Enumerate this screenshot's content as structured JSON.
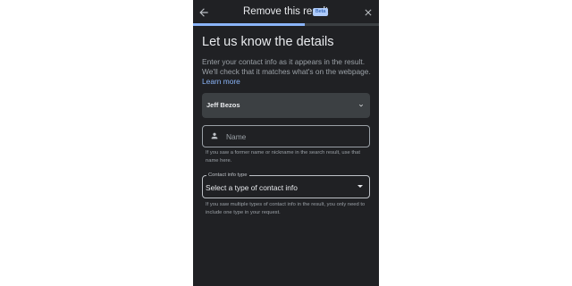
{
  "header": {
    "title": "Remove this result",
    "badge": "Beta"
  },
  "progress": {
    "fraction": 0.6
  },
  "main": {
    "title": "Let us know the details",
    "intro": "Enter your contact info as it appears in the result. We'll check that it matches what's on the webpage.",
    "learn_more": "Learn more",
    "person_select": {
      "value": "Jeff Bezos"
    },
    "name_field": {
      "placeholder": "Name",
      "value": "",
      "helper": "If you saw a former name or nickname in the search result, use that name here."
    },
    "contact_type": {
      "label": "Contact info type",
      "value": "Select a type of contact info",
      "helper": "If you saw multiple types of contact info in the result, you only need to include one type in your request."
    }
  },
  "colors": {
    "background": "#202124",
    "accent": "#8ab4f8",
    "badge_bg": "#aecbfa",
    "text": "#e8eaed",
    "muted_text": "#9aa0a6"
  },
  "icons": {
    "back": "arrow-back-icon",
    "close": "close-icon",
    "dropdown": "chevron-down-icon",
    "person": "person-icon",
    "select": "caret-down-icon"
  }
}
